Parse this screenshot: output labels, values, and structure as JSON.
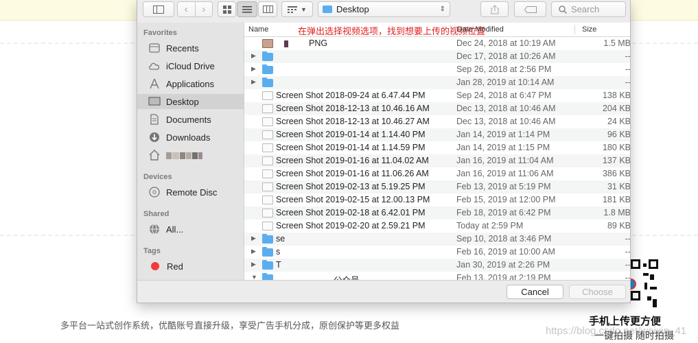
{
  "toolbar": {
    "location": "Desktop",
    "search_placeholder": "Search"
  },
  "annotation": "在弹出选择视频选项，找到想要上传的视频位置",
  "sidebar": {
    "favorites_header": "Favorites",
    "devices_header": "Devices",
    "shared_header": "Shared",
    "tags_header": "Tags",
    "items": [
      {
        "label": "Recents",
        "icon": "clock-icon"
      },
      {
        "label": "iCloud Drive",
        "icon": "cloud-icon"
      },
      {
        "label": "Applications",
        "icon": "applications-icon"
      },
      {
        "label": "Desktop",
        "icon": "desktop-icon"
      },
      {
        "label": "Documents",
        "icon": "document-icon"
      },
      {
        "label": "Downloads",
        "icon": "download-icon"
      },
      {
        "label": "Remote Disc",
        "icon": "disc-icon"
      },
      {
        "label": "All...",
        "icon": "network-icon"
      },
      {
        "label": "Red",
        "icon": "red-tag-icon"
      }
    ]
  },
  "columns": {
    "name": "Name",
    "date": "Date Modified",
    "size": "Size"
  },
  "files": [
    {
      "name": "PNG",
      "date": "Dec 24, 2018 at 10:19 AM",
      "size": "1.5 MB"
    },
    {
      "name": "",
      "date": "Dec 17, 2018 at 10:26 AM",
      "size": "--"
    },
    {
      "name": "",
      "date": "Sep 26, 2018 at 2:56 PM",
      "size": "--"
    },
    {
      "name": "",
      "date": "Jan 28, 2019 at 10:14 AM",
      "size": "--"
    },
    {
      "name": "Screen Shot 2018-09-24 at 6.47.44 PM",
      "date": "Sep 24, 2018 at 6:47 PM",
      "size": "138 KB"
    },
    {
      "name": "Screen Shot 2018-12-13 at 10.46.16 AM",
      "date": "Dec 13, 2018 at 10:46 AM",
      "size": "204 KB"
    },
    {
      "name": "Screen Shot 2018-12-13 at 10.46.27 AM",
      "date": "Dec 13, 2018 at 10:46 AM",
      "size": "24 KB"
    },
    {
      "name": "Screen Shot 2019-01-14 at 1.14.40 PM",
      "date": "Jan 14, 2019 at 1:14 PM",
      "size": "96 KB"
    },
    {
      "name": "Screen Shot 2019-01-14 at 1.14.59 PM",
      "date": "Jan 14, 2019 at 1:15 PM",
      "size": "180 KB"
    },
    {
      "name": "Screen Shot 2019-01-16 at 11.04.02 AM",
      "date": "Jan 16, 2019 at 11:04 AM",
      "size": "137 KB"
    },
    {
      "name": "Screen Shot 2019-01-16 at 11.06.26 AM",
      "date": "Jan 16, 2019 at 11:06 AM",
      "size": "386 KB"
    },
    {
      "name": "Screen Shot 2019-02-13 at 5.19.25 PM",
      "date": "Feb 13, 2019 at 5:19 PM",
      "size": "31 KB"
    },
    {
      "name": "Screen Shot 2019-02-15 at 12.00.13 PM",
      "date": "Feb 15, 2019 at 12:00 PM",
      "size": "181 KB"
    },
    {
      "name": "Screen Shot 2019-02-18 at 6.42.01 PM",
      "date": "Feb 18, 2019 at 6:42 PM",
      "size": "1.8 MB"
    },
    {
      "name": "Screen Shot 2019-02-20 at 2.59.21 PM",
      "date": "Today at 2:59 PM",
      "size": "89 KB"
    },
    {
      "name": "se",
      "date": "Sep 10, 2018 at 3:46 PM",
      "size": "--"
    },
    {
      "name": "s",
      "date": "Feb 16, 2019 at 10:00 AM",
      "size": "--"
    },
    {
      "name": "T",
      "date": "Jan 30, 2019 at 2:26 PM",
      "size": "--"
    },
    {
      "name": "公众号",
      "date": "Feb 13, 2019 at 2:19 PM",
      "size": "--"
    }
  ],
  "buttons": {
    "cancel": "Cancel",
    "choose": "Choose"
  },
  "page": {
    "footer_text": "多平台一站式创作系统，优酷账号直接升级，享受广告手机分成，原创保护等更多权益",
    "promo_title": "手机上传更方便",
    "promo_sub": "一键拍摄 随时拍摄",
    "watermark": "https://blog.csdn.net/weixin_41"
  }
}
